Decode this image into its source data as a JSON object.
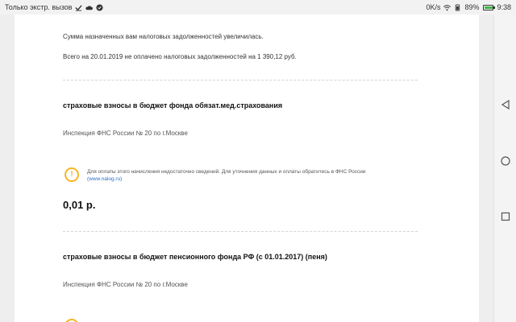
{
  "status_bar": {
    "carrier_text": "Только экстр. вызов",
    "speed": "0K/s",
    "battery_percent": "89%",
    "battery_level": 0.89,
    "time": "9:38",
    "icons": [
      "check-icon",
      "cloud-icon",
      "shield-icon",
      "wifi-icon",
      "battery-icon"
    ]
  },
  "notice": {
    "line1": "Сумма назначенных вам налоговых задолженностей увеличилась.",
    "line2": "Всего на 20.01.2019 не оплачено налоговых задолженностей на 1 390,12 руб."
  },
  "items": [
    {
      "title": "страховые взносы в бюджет фонда обязат.мед.страхования",
      "inspection": "Инспекция ФНС России № 20 по г.Москве",
      "warning_text": "Для оплаты этого начисления недостаточно сведений. Для уточнения данных и оплаты обратитесь в ФНС России",
      "warning_link": "(www.nalog.ru)",
      "amount": "0,01 р."
    },
    {
      "title": "страховые взносы в бюджет пенсионного фонда РФ (с 01.01.2017) (пеня)",
      "inspection": "Инспекция ФНС России № 20 по г.Москве"
    }
  ],
  "colors": {
    "warning": "#f5b626",
    "link": "#2a6fc9",
    "battery": "#3fb649"
  },
  "nav_icons": [
    "back-icon",
    "home-icon",
    "recents-icon"
  ]
}
